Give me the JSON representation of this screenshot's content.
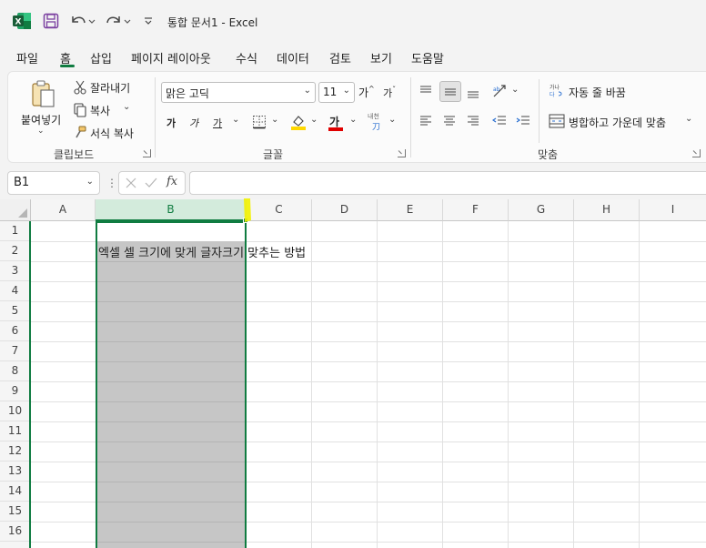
{
  "app": {
    "title": "통합 문서1  -  Excel",
    "accent": "#107c41"
  },
  "tabs": [
    "파일",
    "홈",
    "삽입",
    "페이지 레이아웃",
    "수식",
    "데이터",
    "검토",
    "보기",
    "도움말"
  ],
  "active_tab": "홈",
  "clipboard": {
    "paste_label": "붙여넣기",
    "cut_label": "잘라내기",
    "copy_label": "복사",
    "format_painter_label": "서식 복사",
    "group_label": "클립보드"
  },
  "font": {
    "font_name": "맑은 고딕",
    "font_size": "11",
    "grow_label": "가",
    "shrink_label": "가",
    "bold_label": "가",
    "italic_label": "가",
    "underline_label": "가",
    "font_color_label": "가",
    "phonetic_label": "내천",
    "group_label": "글꼴",
    "highlight_color": "#ffd800",
    "font_color": "#e00000"
  },
  "alignment": {
    "wrap_text_label": "자동 줄 바꿈",
    "merge_center_label": "병합하고 가운데 맞춤",
    "group_label": "맞춤"
  },
  "formula_bar": {
    "name_box": "B1",
    "fx_label": "fx",
    "formula": ""
  },
  "grid": {
    "columns": [
      "A",
      "B",
      "C",
      "D",
      "E",
      "F",
      "G",
      "H",
      "I"
    ],
    "selected_column": "B",
    "rows": [
      "1",
      "2",
      "3",
      "4",
      "5",
      "6",
      "7",
      "8",
      "9",
      "10",
      "11",
      "12",
      "13",
      "14",
      "15",
      "16"
    ],
    "cell_b2": "엑셀 셀 크기에 맞게 글자크기 맞추는 방법"
  }
}
